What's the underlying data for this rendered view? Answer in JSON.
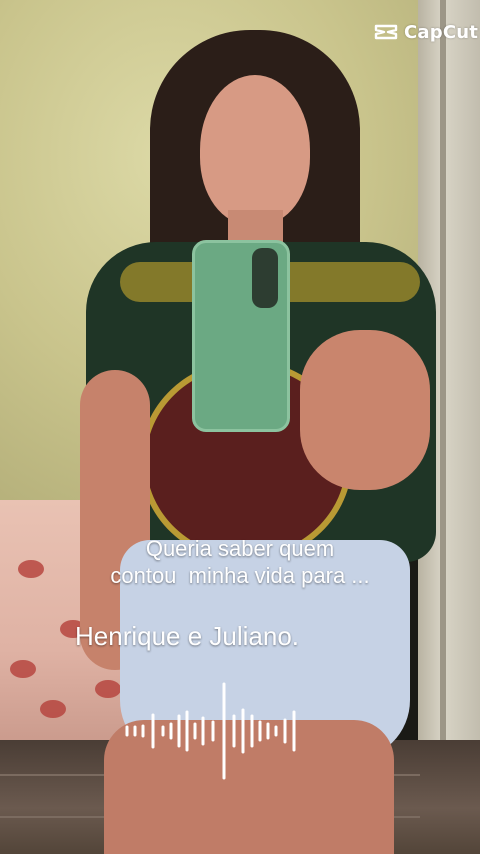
{
  "watermark": {
    "brand": "CapCut",
    "icon": "capcut-logo-icon",
    "color": "#ffffff"
  },
  "lyrics": {
    "line1": "Queria saber quem",
    "line2": "contou  minha vida para ...",
    "line3": "Henrique e Juliano."
  },
  "audio_visualizer": {
    "icon": "audio-waveform-icon",
    "color": "#ffffff"
  }
}
